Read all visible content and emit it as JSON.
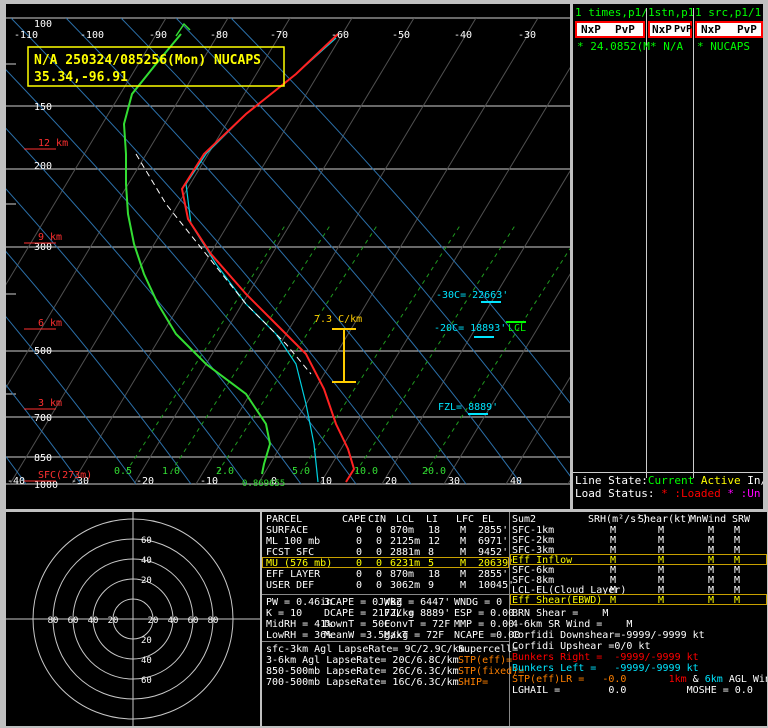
{
  "skewt": {
    "header_line1": "N/A 250324/085256(Mon) NUCAPS",
    "header_line2": "35.34,-96.91",
    "temp_ticks": [
      "-110",
      "-100",
      "-90",
      "-80",
      "-70",
      "-60",
      "-50",
      "-40",
      "-30"
    ],
    "bottom_ticks": [
      "-40",
      "-30",
      "-20",
      "-10",
      "0",
      "10",
      "20",
      "30",
      "40"
    ],
    "pressure_labels": [
      "100",
      "150",
      "200",
      "300",
      "500",
      "700",
      "850",
      "1000"
    ],
    "height_labels": [
      "12 km",
      "9 km",
      "6 km",
      "3 km",
      "SFC(273m)"
    ],
    "mixing_ratio_labels": [
      "0.5",
      "1.0",
      "2.0",
      "5.0",
      "10.0",
      "20.0"
    ],
    "surface_values": "0.869655",
    "lapse_rate": "7.3 C/km",
    "level_30": "-30C= 22663'",
    "level_20": "-20C= 18893'",
    "lcl": "LCL",
    "fzl": "FZL= 8889'"
  },
  "right_panel": {
    "tabs": [
      {
        "header": "1 times,p1/",
        "prev": "NxP",
        "next": "PvP",
        "value": "* 24.0852(M"
      },
      {
        "header": "1stn,p1",
        "prev": "NxP",
        "next": "PvP",
        "value": "* N/A"
      },
      {
        "header": "1 src,p1/1",
        "prev": "NxP",
        "next": "PvP",
        "value": "* NUCAPS"
      }
    ],
    "line_state_label": "Line State:",
    "line_state_current": "Current",
    "line_state_active": "Active",
    "line_state_tail": "In/",
    "load_status_label": "Load Status:",
    "load_status_loaded": "* :Loaded",
    "load_status_un": "* :Un"
  },
  "hodograph": {
    "ring_labels": [
      "80",
      "60",
      "40",
      "20",
      "20",
      "40",
      "60",
      "80"
    ]
  },
  "parcel_table": {
    "headers": [
      "PARCEL",
      "CAPE",
      "CIN",
      "LCL",
      "LI",
      "LFC",
      "EL"
    ],
    "rows": [
      [
        "SURFACE",
        "0",
        "0",
        "870m",
        "18",
        "M",
        "2855'"
      ],
      [
        "ML 100 mb",
        "0",
        "0",
        "2125m",
        "12",
        "M",
        "6971'"
      ],
      [
        "FCST SFC",
        "0",
        "0",
        "2881m",
        "8",
        "M",
        "9452'"
      ],
      [
        "MU (576 mb)",
        "0",
        "0",
        "6231m",
        "5",
        "M",
        "20639'"
      ],
      [
        "EFF LAYER",
        "0",
        "0",
        "870m",
        "18",
        "M",
        "2855'"
      ],
      [
        "USER DEF",
        "0",
        "0",
        "3062m",
        "9",
        "M",
        "10045'"
      ]
    ]
  },
  "indices": [
    "PW = 0.46in",
    "K = 10",
    "MidRH = 41%",
    "LowRH = 36%"
  ],
  "indices2": [
    "3CAPE = 0J/kg",
    "DCAPE = 217J/kg",
    "DownT = 50F",
    "MeanW =3.5g/kg"
  ],
  "indices3": [
    "WBZ = 6447'",
    "FZL = 8889'",
    "ConvT = 72F",
    "MaxT = 72F"
  ],
  "indices4": [
    "WNDG = 0",
    "ESP = 0.00",
    "MMP = 0.00",
    "NCAPE =0.00"
  ],
  "lapse_rates": [
    "sfc-3km Agl LapseRate= 9C/2.9C/km",
    "3-6km Agl LapseRate= 20C/6.8C/km",
    "850-500mb LapseRate= 26C/6.3C/km",
    "700-500mb LapseRate= 16C/6.3C/km"
  ],
  "supercell": [
    "Supercell=",
    "STP(eff)=",
    "STP(fixed)=",
    "SHIP="
  ],
  "shear_table": {
    "headers": [
      "Sum2",
      "SRH(m²/s²)",
      "Shear(kt)",
      "MnWind",
      "SRW"
    ],
    "rows": [
      [
        "SFC-1km",
        "M",
        "M",
        "M",
        "M"
      ],
      [
        "SFC-2km",
        "M",
        "M",
        "M",
        "M"
      ],
      [
        "SFC-3km",
        "M",
        "M",
        "M",
        "M"
      ],
      [
        "Eff Inflow",
        "M",
        "M",
        "M",
        "M"
      ],
      [
        "SFC-6km",
        "M",
        "M",
        "M",
        "M"
      ],
      [
        "SFC-8km",
        "M",
        "M",
        "M",
        "M"
      ],
      [
        "LCL-EL(Cloud Layer)",
        "M",
        "M",
        "M",
        "M"
      ],
      [
        "Eff Shear(EBWD)",
        "M",
        "M",
        "M",
        "M"
      ]
    ]
  },
  "bottom_right": {
    "brn": "BRN Shear =",
    "brn_val": "M",
    "srw": "4-6km SR Wind =",
    "srw_val": "M",
    "corfidi_down": "Corfidi Downshear=-9999/-9999 kt",
    "corfidi_up": "Corfidi Upshear =0/0 kt",
    "bunkers_right": "Bunkers Right =",
    "bunkers_right_val": "-9999/-9999 kt",
    "bunkers_left": "Bunkers Left =",
    "bunkers_left_val": "-9999/-9999 kt",
    "stp_lr": "STP(eff)LR =",
    "stp_lr_val": "-0.0",
    "lkm": "1km",
    "amp": "&",
    "skm": "6km",
    "agl": "AGL Wind",
    "lghail": "LGHAIL =",
    "lghail_val": "0.0",
    "moshe": "MOSHE = 0.0"
  }
}
